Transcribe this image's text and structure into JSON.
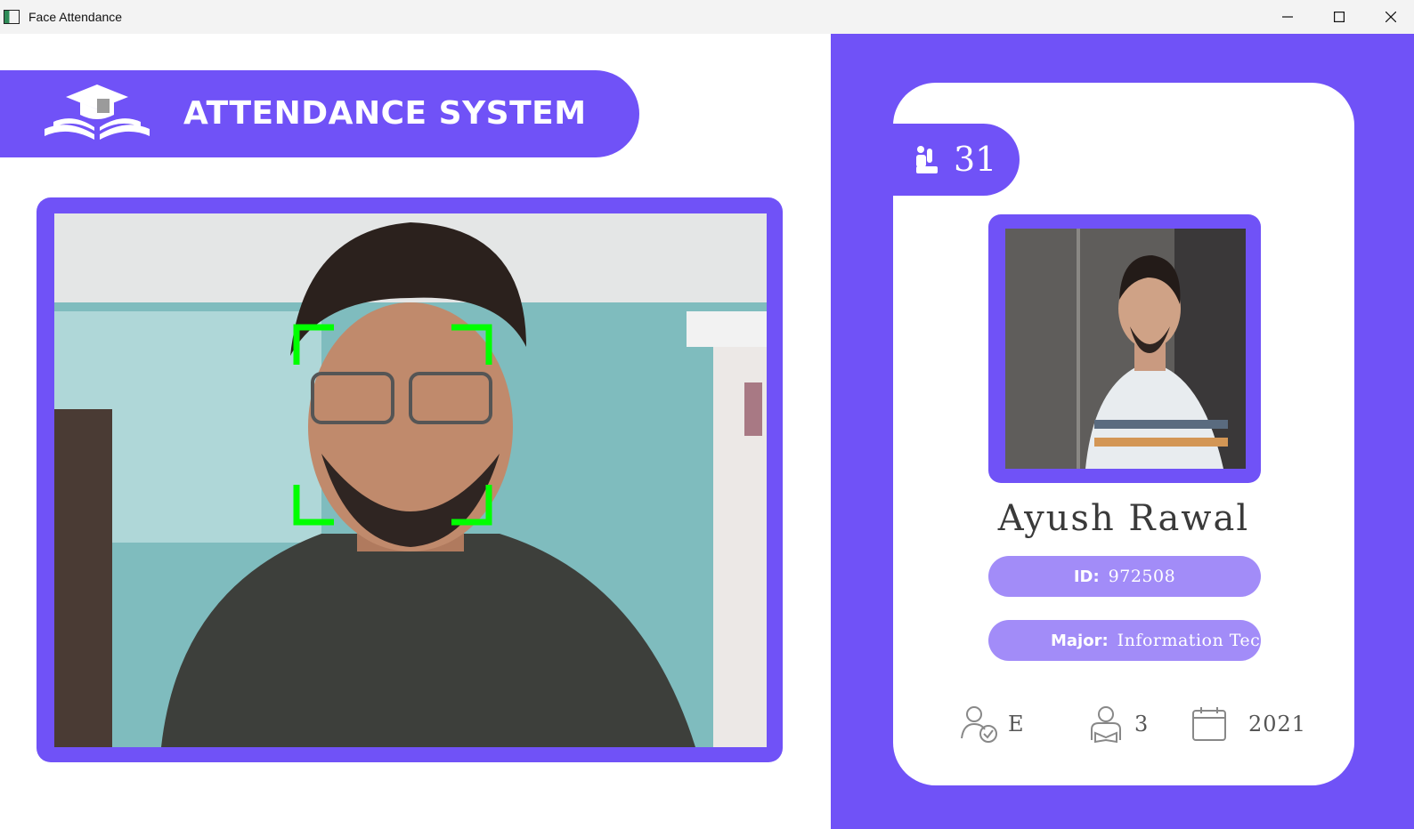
{
  "window": {
    "title": "Face Attendance",
    "controls": [
      "minimize-icon",
      "maximize-icon",
      "close-icon"
    ]
  },
  "banner": {
    "title": "ATTENDANCE SYSTEM",
    "logo_icon": "graduation-book-icon"
  },
  "camera": {
    "face_box_color": "#00ff00"
  },
  "student": {
    "total_attendance": "31",
    "name": "Ayush Rawal",
    "id_label": "ID:",
    "id_value": "972508",
    "major_label": "Major:",
    "major_value": "Information Technology",
    "standing": "E",
    "year": "3",
    "starting_year": "2021"
  },
  "icons": {
    "attendance": "raised-hand-icon",
    "standing": "user-check-icon",
    "year": "student-reading-icon",
    "starting_year": "calendar-icon"
  },
  "colors": {
    "accent": "#7052f7",
    "pill": "#a28cf8",
    "background": "#ffffff"
  }
}
